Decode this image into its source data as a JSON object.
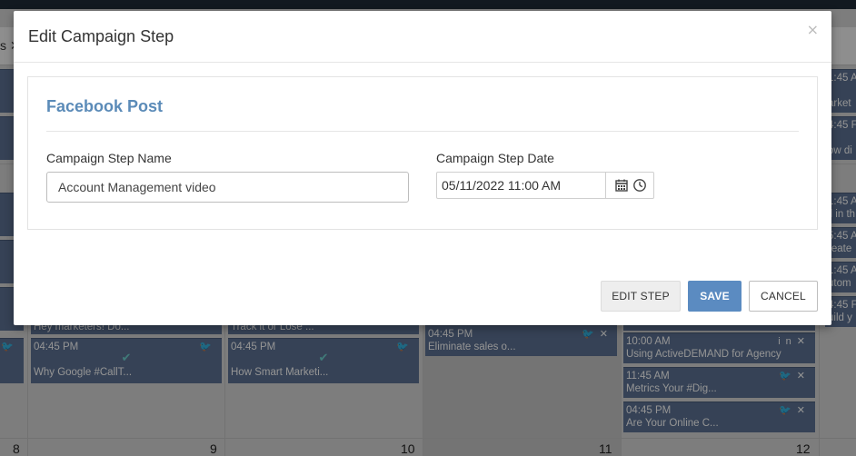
{
  "background": {
    "tab_fragment": "s ✕",
    "cards": [
      {
        "time": "",
        "text": "Hey marketers! Do...",
        "icons": ""
      },
      {
        "time": "04:45 PM",
        "text": "Why Google #CallT...",
        "icons": "twitter",
        "posted": true
      },
      {
        "time": "",
        "text": "Track it or Lose ...",
        "icons": ""
      },
      {
        "time": "04:45 PM",
        "text": "How Smart Marketi...",
        "icons": "twitter",
        "posted": true
      },
      {
        "time": "04:45 PM",
        "text": "Eliminate sales o...",
        "icons": "twitter"
      },
      {
        "time": "10:00 AM",
        "text": "Using ActiveDEMAND for Agency",
        "icons": "linkedin"
      },
      {
        "time": "11:45 AM",
        "text": "Metrics Your #Dig...",
        "icons": "twitter"
      },
      {
        "time": "04:45 PM",
        "text": "Are Your Online C...",
        "icons": "twitter"
      }
    ],
    "right_edge_cards": [
      "1:45 A",
      "arket",
      "4:45 F",
      "ow di",
      "1:45 A",
      "ll in th",
      "5:45 A",
      "reate",
      "1:45 A",
      "utom",
      "4:45 F",
      "uild y"
    ],
    "day_numbers": [
      "8",
      "9",
      "10",
      "11",
      "12"
    ]
  },
  "modal": {
    "title": "Edit Campaign Step",
    "close_label": "×",
    "panel_title": "Facebook Post",
    "name_label": "Campaign Step Name",
    "name_value": "Account Management video",
    "date_label": "Campaign Step Date",
    "date_value": "05/11/2022 11:00 AM",
    "icons": {
      "calendar": "calendar-icon",
      "clock": "clock-icon"
    },
    "buttons": {
      "edit": "EDIT STEP",
      "save": "SAVE",
      "cancel": "CANCEL"
    },
    "colors": {
      "accent": "#5b8bb8",
      "save": "#5b8bc1",
      "card": "#5e7394"
    }
  }
}
